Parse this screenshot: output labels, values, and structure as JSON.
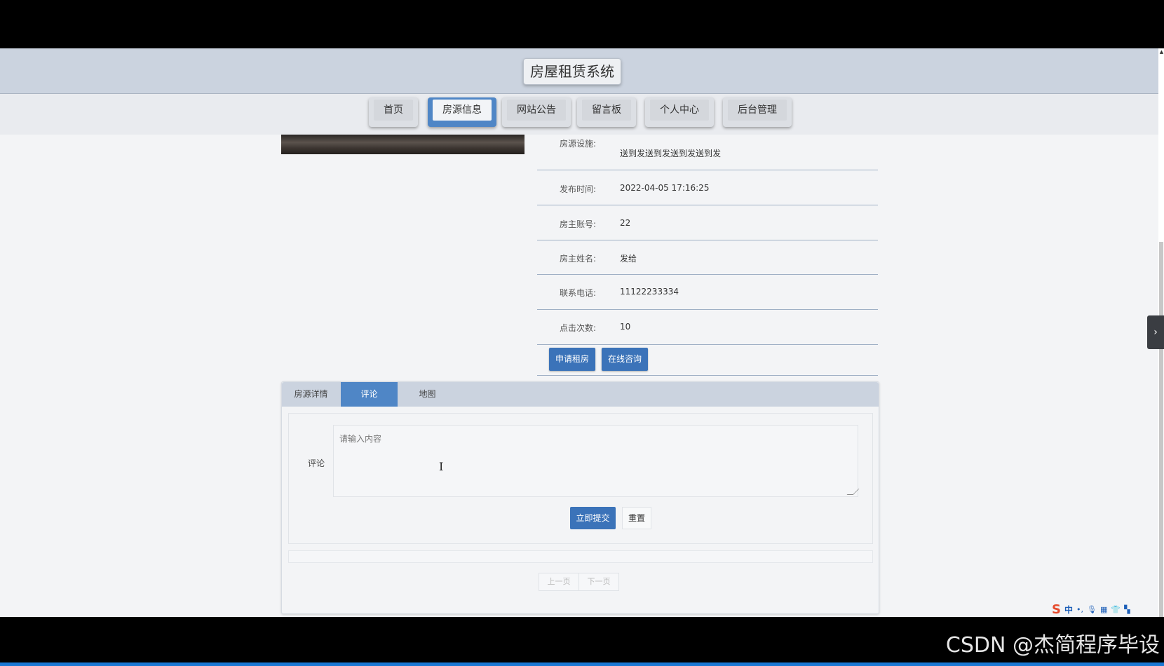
{
  "header": {
    "title": "房屋租赁系统"
  },
  "nav": {
    "items": [
      {
        "label": "首页"
      },
      {
        "label": "房源信息"
      },
      {
        "label": "网站公告"
      },
      {
        "label": "留言板"
      },
      {
        "label": "个人中心"
      },
      {
        "label": "后台管理"
      }
    ],
    "active_index": 1
  },
  "details": {
    "rows": [
      {
        "label": "房源设施:",
        "value": "送到发送到发送到发送到发"
      },
      {
        "label": "发布时间:",
        "value": "2022-04-05 17:16:25"
      },
      {
        "label": "房主账号:",
        "value": "22"
      },
      {
        "label": "房主姓名:",
        "value": "发给"
      },
      {
        "label": "联系电话:",
        "value": "11122233334"
      },
      {
        "label": "点击次数:",
        "value": "10"
      }
    ],
    "apply_button": "申请租房",
    "consult_button": "在线咨询"
  },
  "tabs": {
    "items": [
      {
        "label": "房源详情"
      },
      {
        "label": "评论"
      },
      {
        "label": "地图"
      }
    ],
    "active_index": 1
  },
  "comment_form": {
    "label": "评论",
    "placeholder": "请输入内容",
    "submit_label": "立即提交",
    "reset_label": "重置"
  },
  "pagination": {
    "prev_label": "上一页",
    "next_label": "下一页"
  },
  "ime": {
    "mode": "中"
  },
  "watermark": "CSDN @杰简程序毕设",
  "colors": {
    "primary": "#3b73b9",
    "active_tab": "#4f86c6",
    "header_bg": "#cbd3df"
  }
}
